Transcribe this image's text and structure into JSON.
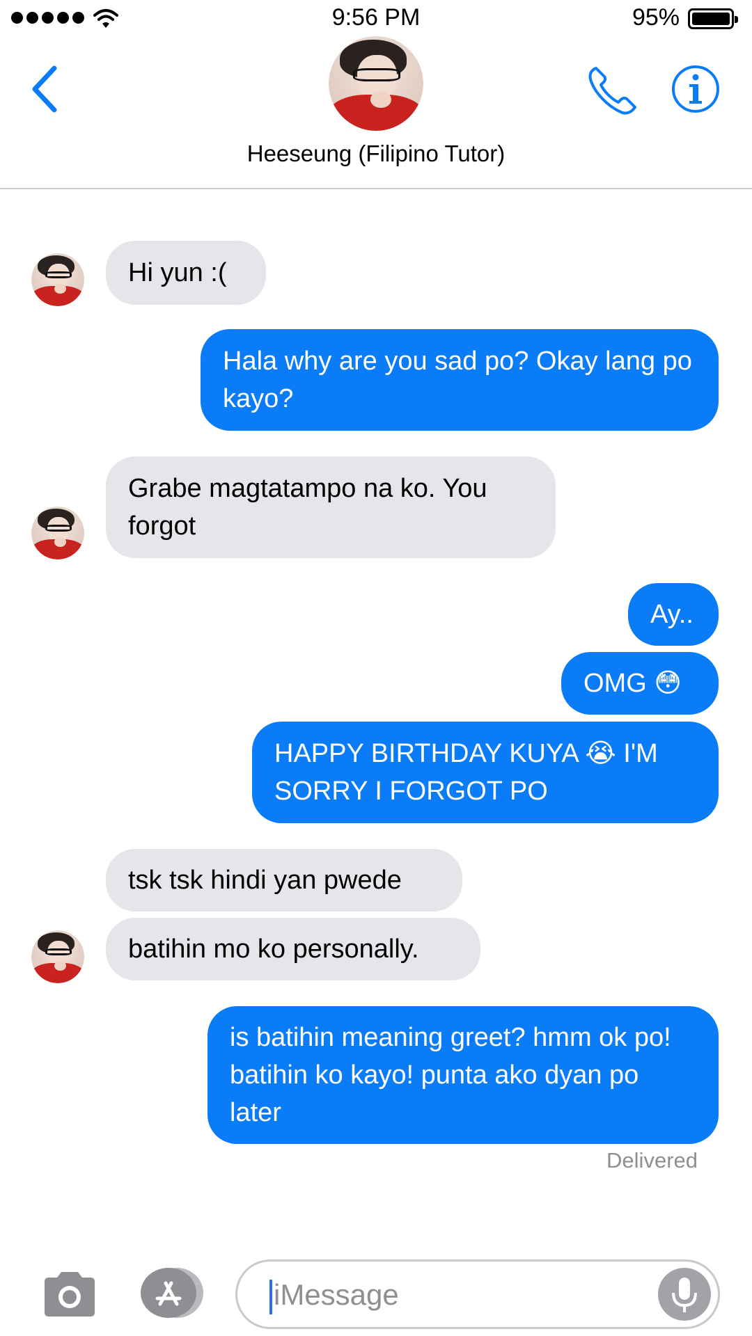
{
  "status_bar": {
    "time": "9:56 PM",
    "battery_percent": "95%"
  },
  "header": {
    "contact_name": "Heeseung (Filipino Tutor)"
  },
  "messages": [
    {
      "direction": "in",
      "text": "Hi yun :("
    },
    {
      "direction": "out",
      "text": "Hala why are you sad po? Okay lang po kayo?"
    },
    {
      "direction": "in",
      "text": "Grabe magtatampo na ko. You forgot"
    },
    {
      "direction": "out",
      "text": "Ay.."
    },
    {
      "direction": "out",
      "text": "OMG 😳"
    },
    {
      "direction": "out",
      "text": "HAPPY BIRTHDAY KUYA 😭 I'M SORRY I FORGOT PO"
    },
    {
      "direction": "in",
      "text": "tsk tsk hindi yan pwede"
    },
    {
      "direction": "in",
      "text": "batihin mo ko personally."
    },
    {
      "direction": "out",
      "text": "is batihin meaning greet? hmm ok po! batihin ko kayo! punta ako dyan po later"
    }
  ],
  "delivery_status": "Delivered",
  "composer": {
    "placeholder": "iMessage"
  },
  "colors": {
    "accent": "#0a7cf7",
    "incoming_bubble": "#e5e5ea",
    "outgoing_bubble": "#0a7cf7"
  },
  "icons": [
    "back-chevron-icon",
    "phone-icon",
    "info-icon",
    "camera-icon",
    "app-store-icon",
    "microphone-icon",
    "wifi-icon",
    "battery-icon"
  ]
}
